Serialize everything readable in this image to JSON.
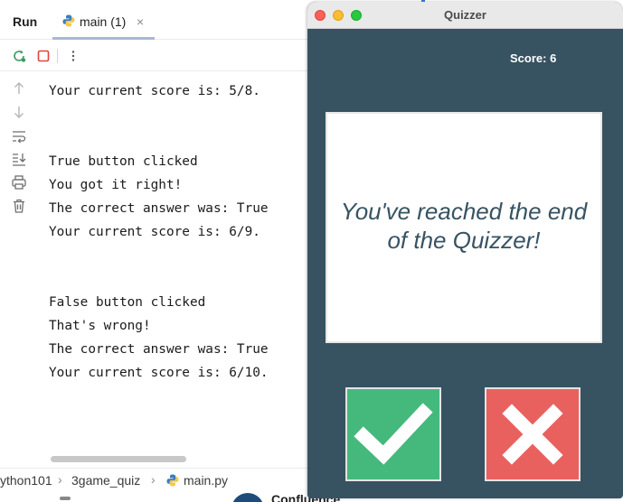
{
  "ide": {
    "panel_label": "Run",
    "tab_label": "main (1)",
    "tab_close": "×",
    "console_lines": [
      "Your current score is: 5/8.",
      "",
      "",
      "True button clicked",
      "You got it right!",
      "The correct answer was: True",
      "Your current score is: 6/9.",
      "",
      "",
      "False button clicked",
      "That's wrong!",
      "The correct answer was: True",
      "Your current score is: 6/10."
    ],
    "breadcrumb": [
      "ython101",
      "3game_quiz",
      "main.py"
    ],
    "breadcrumb_separator": "›",
    "bottom_app_label": "Confluence"
  },
  "quiz_window": {
    "title": "Quizzer",
    "score_text": "Score: 6",
    "question_text": "You've reached the end of the Quizzer!",
    "background_color": "#375362",
    "true_button_color": "#45b97c",
    "false_button_color": "#e8615e",
    "true_icon": "check-icon",
    "false_icon": "cross-icon"
  }
}
